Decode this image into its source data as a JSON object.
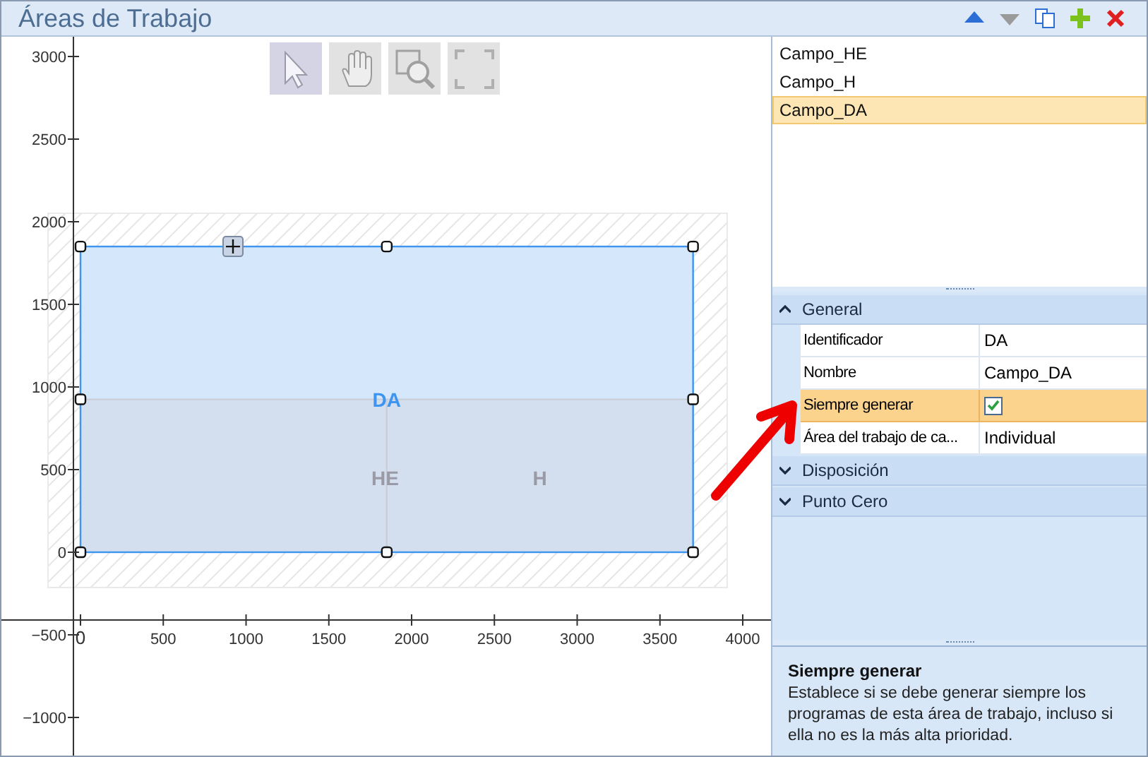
{
  "window": {
    "title": "Áreas de Trabajo"
  },
  "header_actions": [
    {
      "kind": "up",
      "disabled": false
    },
    {
      "kind": "down",
      "disabled": true
    },
    {
      "kind": "copy",
      "disabled": false
    },
    {
      "kind": "add",
      "disabled": false
    },
    {
      "kind": "delete",
      "disabled": false
    }
  ],
  "tools": [
    {
      "kind": "select",
      "selected": true
    },
    {
      "kind": "pan",
      "selected": false
    },
    {
      "kind": "zoom",
      "selected": false
    },
    {
      "kind": "extents",
      "selected": false
    }
  ],
  "canvas": {
    "y_ticks": [
      "3000",
      "2500",
      "2000",
      "1500",
      "1000",
      "500",
      "0",
      "−500",
      "−1000"
    ],
    "x_ticks": [
      "0",
      "500",
      "1000",
      "1500",
      "2000",
      "2500",
      "3000",
      "3500",
      "4000"
    ],
    "areas": [
      {
        "label": "DA",
        "selected": true
      },
      {
        "label": "HE",
        "selected": false
      },
      {
        "label": "H",
        "selected": false
      }
    ]
  },
  "list": [
    {
      "label": "Campo_HE",
      "selected": false
    },
    {
      "label": "Campo_H",
      "selected": false
    },
    {
      "label": "Campo_DA",
      "selected": true
    }
  ],
  "properties": [
    {
      "title": "General",
      "expanded": true,
      "rows": [
        {
          "kind": "text",
          "name": "Identificador",
          "value": "DA",
          "selected": false
        },
        {
          "kind": "text",
          "name": "Nombre",
          "value": "Campo_DA",
          "selected": false
        },
        {
          "kind": "checkbox",
          "name": "Siempre generar",
          "checked": true,
          "selected": true
        },
        {
          "kind": "text",
          "name": "Área del trabajo de ca...",
          "value": "Individual",
          "selected": false
        }
      ]
    },
    {
      "title": "Disposición",
      "expanded": false
    },
    {
      "title": "Punto Cero",
      "expanded": false
    }
  ],
  "description": {
    "title": "Siempre generar",
    "text": "Establece si se debe generar siempre los programas de esta área de trabajo, incluso si ella no es la más alta prioridad."
  }
}
